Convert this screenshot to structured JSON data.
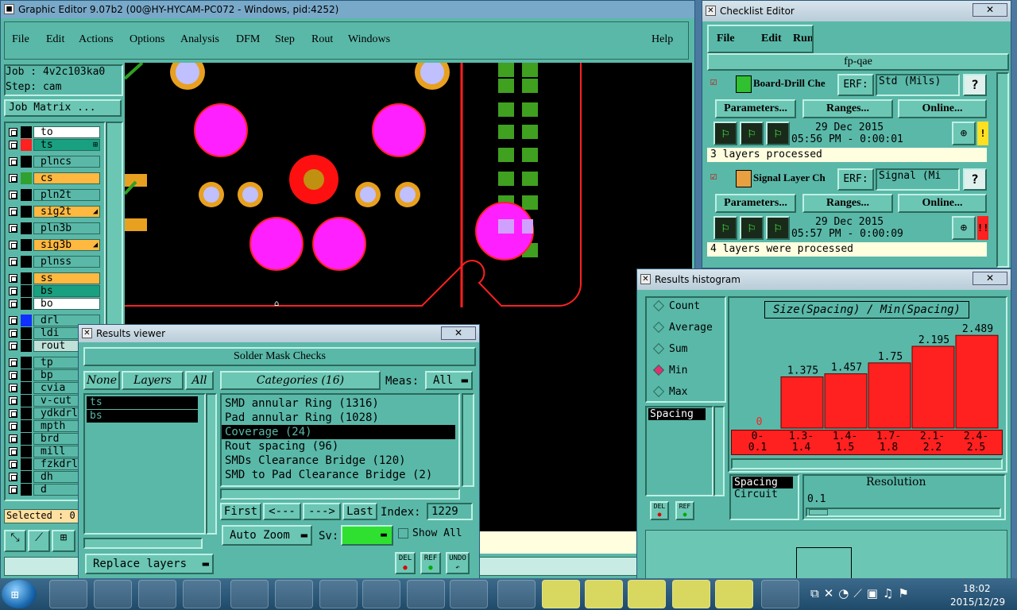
{
  "ge": {
    "title": "Graphic Editor 9.07b2 (00@HY-HYCAM-PC072 - Windows, pid:4252)",
    "menu": [
      "File",
      "Edit",
      "Actions",
      "Options",
      "Analysis",
      "DFM",
      "Step",
      "Rout",
      "Windows"
    ],
    "help": "Help",
    "job": "Job : 4v2c103ka0",
    "step": "Step: cam",
    "job_matrix": "Job Matrix ...",
    "layers": [
      {
        "name": "to",
        "color": "#ffffff",
        "sw": "#000000"
      },
      {
        "name": "ts",
        "color": "#19a080",
        "sw": "#ff2020",
        "mark": "⊞"
      },
      {
        "name": "plncs",
        "color": "#5ab8a8",
        "sw": "#000000"
      },
      {
        "name": "cs",
        "color": "#ffb840",
        "sw": "#30a030"
      },
      {
        "name": "pln2t",
        "color": "#5ab8a8",
        "sw": "#000000"
      },
      {
        "name": "sig2t",
        "color": "#ffb840",
        "sw": "#000000",
        "mark": "◢"
      },
      {
        "name": "pln3b",
        "color": "#5ab8a8",
        "sw": "#000000"
      },
      {
        "name": "sig3b",
        "color": "#ffb840",
        "sw": "#000000",
        "mark": "◢"
      },
      {
        "name": "plnss",
        "color": "#5ab8a8",
        "sw": "#000000"
      },
      {
        "name": "ss",
        "color": "#ffb840",
        "sw": "#000000"
      },
      {
        "name": "bs",
        "color": "#19a080",
        "sw": "#000000"
      },
      {
        "name": "bo",
        "color": "#ffffff",
        "sw": "#000000"
      },
      {
        "name": "drl",
        "color": "#5ab8a8",
        "sw": "#1030ff"
      },
      {
        "name": "ldi",
        "color": "#5ab8a8",
        "sw": "#000000"
      },
      {
        "name": "rout",
        "color": "#c0e0d8",
        "sw": "#000000"
      },
      {
        "name": "tp",
        "color": "#5ab8a8",
        "sw": "#000000"
      },
      {
        "name": "bp",
        "color": "#5ab8a8",
        "sw": "#000000"
      },
      {
        "name": "cvia",
        "color": "#5ab8a8",
        "sw": "#000000"
      },
      {
        "name": "v-cut",
        "color": "#5ab8a8",
        "sw": "#000000"
      },
      {
        "name": "ydkdrl",
        "color": "#5ab8a8",
        "sw": "#000000"
      },
      {
        "name": "mpth",
        "color": "#5ab8a8",
        "sw": "#000000"
      },
      {
        "name": "brd",
        "color": "#5ab8a8",
        "sw": "#000000"
      },
      {
        "name": "mill",
        "color": "#5ab8a8",
        "sw": "#000000"
      },
      {
        "name": "fzkdrl",
        "color": "#5ab8a8",
        "sw": "#000000"
      },
      {
        "name": "dh",
        "color": "#5ab8a8",
        "sw": "#000000"
      },
      {
        "name": "d",
        "color": "#5ab8a8",
        "sw": "#000000"
      }
    ],
    "selected": "Selected : 0"
  },
  "rv": {
    "title": "Results viewer",
    "header": "Solder Mask Checks",
    "none": "None",
    "layers": "Layers",
    "all": "All",
    "categories": "Categories (16)",
    "meas": "Meas:",
    "meas_value": "All",
    "layer_items": [
      "ts",
      "bs"
    ],
    "cat_items": [
      "SMD annular Ring (1316)",
      "Pad annular Ring (1028)",
      "Coverage (24)",
      "Rout spacing (96)",
      "SMDs Clearance Bridge (120)",
      "SMD to Pad Clearance Bridge (2)"
    ],
    "first": "First",
    "prev": "<---",
    "next": "--->",
    "last": "Last",
    "index_label": "Index:",
    "index": "1229",
    "auto_zoom": "Auto Zoom",
    "sv": "Sv:",
    "show_all": "Show All",
    "replace": "Replace layers",
    "del": "DEL",
    "ref": "REF",
    "undo": "UNDO"
  },
  "ce": {
    "title": "Checklist Editor",
    "menu": [
      "File",
      "Edit",
      "Run"
    ],
    "name": "fp-qae",
    "checks": [
      {
        "name": "Board-Drill Che",
        "erf": "ERF:",
        "erf_value": "Std (Mils)",
        "params": "Parameters...",
        "ranges": "Ranges...",
        "online": "Online...",
        "date": "29 Dec 2015",
        "time": "05:56 PM - 0:00:01",
        "status": "3 layers processed",
        "flag": "!",
        "flag_color": "#ffe020"
      },
      {
        "name": "Signal Layer Ch",
        "erf": "ERF:",
        "erf_value": "Signal (Mi",
        "params": "Parameters...",
        "ranges": "Ranges...",
        "online": "Online...",
        "date": "29 Dec 2015",
        "time": "05:57 PM - 0:00:09",
        "status": "4 layers were processed",
        "flag": "!!",
        "flag_color": "#ff2020"
      }
    ]
  },
  "rh": {
    "title": "Results histogram",
    "modes": [
      "Count",
      "Average",
      "Sum",
      "Min",
      "Max"
    ],
    "selected_mode": "Min",
    "list": [
      "Spacing"
    ],
    "chart_title": "Size(Spacing) / Min(Spacing)",
    "bins": [
      "0-\n0.1",
      "1.3-\n1.4",
      "1.4-\n1.5",
      "1.7-\n1.8",
      "2.1-\n2.2",
      "2.4-\n2.5"
    ],
    "bottom_list": [
      "Spacing",
      "Circuit"
    ],
    "resolution_label": "Resolution",
    "resolution": "0.1",
    "del": "DEL",
    "ref": "REF"
  },
  "chart_data": {
    "type": "bar",
    "title": "Size(Spacing) / Min(Spacing)",
    "categories": [
      "0-0.1",
      "1.3-1.4",
      "1.4-1.5",
      "1.7-1.8",
      "2.1-2.2",
      "2.4-2.5"
    ],
    "values": [
      0,
      1.375,
      1.457,
      1.75,
      2.195,
      2.489
    ],
    "labels": [
      "0",
      "1.375",
      "1.457",
      "1.75",
      "2.195",
      "2.489"
    ],
    "ylim": [
      0,
      2.6
    ]
  },
  "taskbar": {
    "time": "18:02",
    "date": "2015/12/29"
  }
}
